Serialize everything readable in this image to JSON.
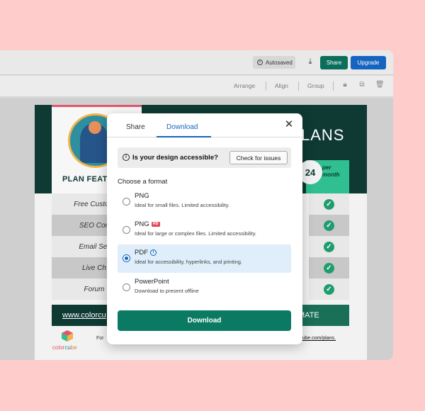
{
  "topbar": {
    "autosaved_label": "Autosaved",
    "share_label": "Share",
    "upgrade_label": "Upgrade",
    "colors": {
      "share": "#0b6e5a",
      "upgrade": "#1565c0"
    }
  },
  "toolbar": {
    "arrange_label": "Arrange",
    "align_label": "Align",
    "group_label": "Group"
  },
  "poster": {
    "plan_features_title": "PLAN FEAT",
    "plans_title": "LANS",
    "price": "24",
    "per_month": "per month",
    "features": [
      "Free Custom",
      "SEO Con",
      "Email Ser",
      "Live Ch",
      "Forum"
    ],
    "website_link": "www.colorcu",
    "ultimate_label": "ULTIMATE",
    "logo_text": [
      "color",
      "c",
      "u",
      "be"
    ],
    "footer_for": "For",
    "footer_url": "cube.com/plans."
  },
  "modal": {
    "tabs": [
      {
        "label": "Share",
        "active": false
      },
      {
        "label": "Download",
        "active": true
      }
    ],
    "accessibility": {
      "question": "Is your design accessible?",
      "button_label": "Check for issues"
    },
    "choose_format_label": "Choose a format",
    "options": [
      {
        "title": "PNG",
        "badge": "",
        "description": "Ideal for small files. Limited accessibility.",
        "selected": false
      },
      {
        "title": "PNG",
        "badge": "HD",
        "description": "Ideal for large or complex files. Limited accessibility.",
        "selected": false
      },
      {
        "title": "PDF",
        "badge": "",
        "description": "Ideal for accessibility, hyperlinks, and printing.",
        "selected": true
      },
      {
        "title": "PowerPoint",
        "badge": "",
        "description": "Download to present offline",
        "selected": false
      }
    ],
    "download_label": "Download",
    "colors": {
      "accent": "#1565c0",
      "download": "#0b7a62"
    }
  }
}
